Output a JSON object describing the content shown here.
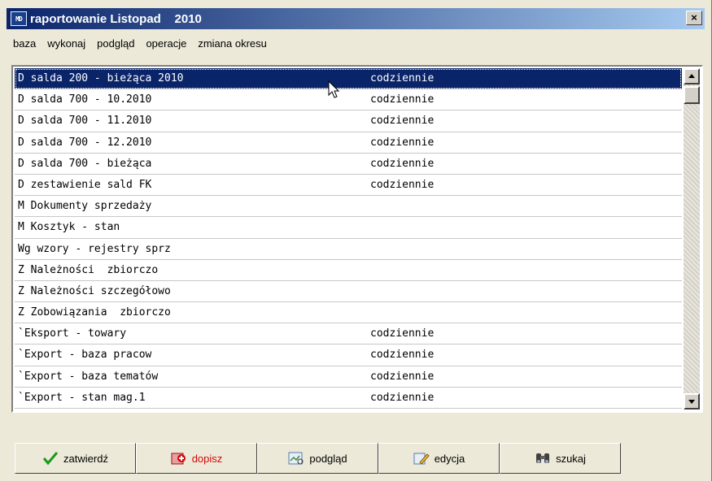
{
  "window": {
    "title": "raportowanie Listopad    2010",
    "app_icon_text": "MD",
    "close_label": "×"
  },
  "menu": [
    "baza",
    "wykonaj",
    "podgląd",
    "operacje",
    "zmiana okresu"
  ],
  "list": {
    "rows": [
      {
        "name": "D salda 200 - bieżąca 2010",
        "freq": "codziennie",
        "selected": true
      },
      {
        "name": "D salda 700 - 10.2010",
        "freq": "codziennie"
      },
      {
        "name": "D salda 700 - 11.2010",
        "freq": "codziennie"
      },
      {
        "name": "D salda 700 - 12.2010",
        "freq": "codziennie"
      },
      {
        "name": "D salda 700 - bieżąca",
        "freq": "codziennie"
      },
      {
        "name": "D zestawienie sald FK",
        "freq": "codziennie"
      },
      {
        "name": "M Dokumenty sprzedaży",
        "freq": ""
      },
      {
        "name": "M Kosztyk - stan",
        "freq": ""
      },
      {
        "name": "Wg wzory - rejestry sprz",
        "freq": ""
      },
      {
        "name": "Z Należności  zbiorczo",
        "freq": ""
      },
      {
        "name": "Z Należności szczegółowo",
        "freq": ""
      },
      {
        "name": "Z Zobowiązania  zbiorczo",
        "freq": ""
      },
      {
        "name": "`Eksport - towary",
        "freq": "codziennie"
      },
      {
        "name": "`Export - baza pracow",
        "freq": "codziennie"
      },
      {
        "name": "`Export - baza tematów",
        "freq": "codziennie"
      },
      {
        "name": "`Export - stan mag.1",
        "freq": "codziennie"
      }
    ]
  },
  "buttons": {
    "confirm": "zatwierdź",
    "add": "dopisz",
    "preview": "podgląd",
    "edit": "edycja",
    "search": "szukaj"
  },
  "colors": {
    "selection": "#0a246a",
    "titlebar_start": "#0a246a",
    "titlebar_end": "#a6caf0",
    "add_label": "#d10a0a"
  }
}
